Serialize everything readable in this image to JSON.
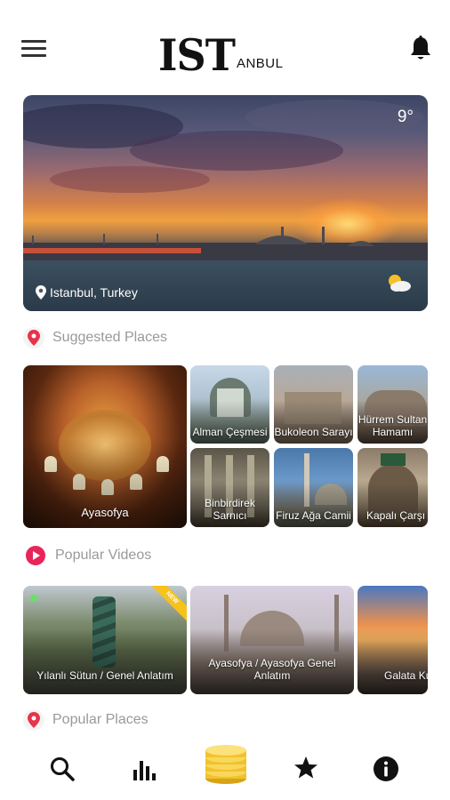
{
  "header": {
    "logo_main": "IST",
    "logo_suffix": "ANBUL",
    "menu_icon": "menu-icon",
    "notification_icon": "bell-icon"
  },
  "hero": {
    "temperature": "9°",
    "location": "Istanbul, Turkey",
    "weather_icon": "partly-cloudy-icon"
  },
  "sections": {
    "suggested_places": "Suggested Places",
    "popular_videos": "Popular Videos",
    "popular_places": "Popular Places"
  },
  "suggested_places": [
    {
      "name": "Ayasofya"
    },
    {
      "name": "Alman Çeşmesi"
    },
    {
      "name": "Bukoleon Sarayı"
    },
    {
      "name": "Hürrem Sultan Hamamı"
    },
    {
      "name": "Binbirdirek Sarnıcı"
    },
    {
      "name": "Firuz Ağa Camii"
    },
    {
      "name": "Kapalı Çarşı"
    }
  ],
  "popular_videos": [
    {
      "title": "Yılanlı Sütun / Genel Anlatım",
      "badge": "NEW"
    },
    {
      "title": "Ayasofya / Ayasofya Genel Anlatım"
    },
    {
      "title": "Galata Kulesi / Genel Anlatım"
    }
  ],
  "nav": {
    "items": [
      "search-icon",
      "stats-icon",
      "coins-icon",
      "star-icon",
      "info-icon"
    ]
  },
  "colors": {
    "accent_red": "#e8334a",
    "video_icon": "#e8255a",
    "section_text": "#999999",
    "coins": "#f2c12e"
  }
}
